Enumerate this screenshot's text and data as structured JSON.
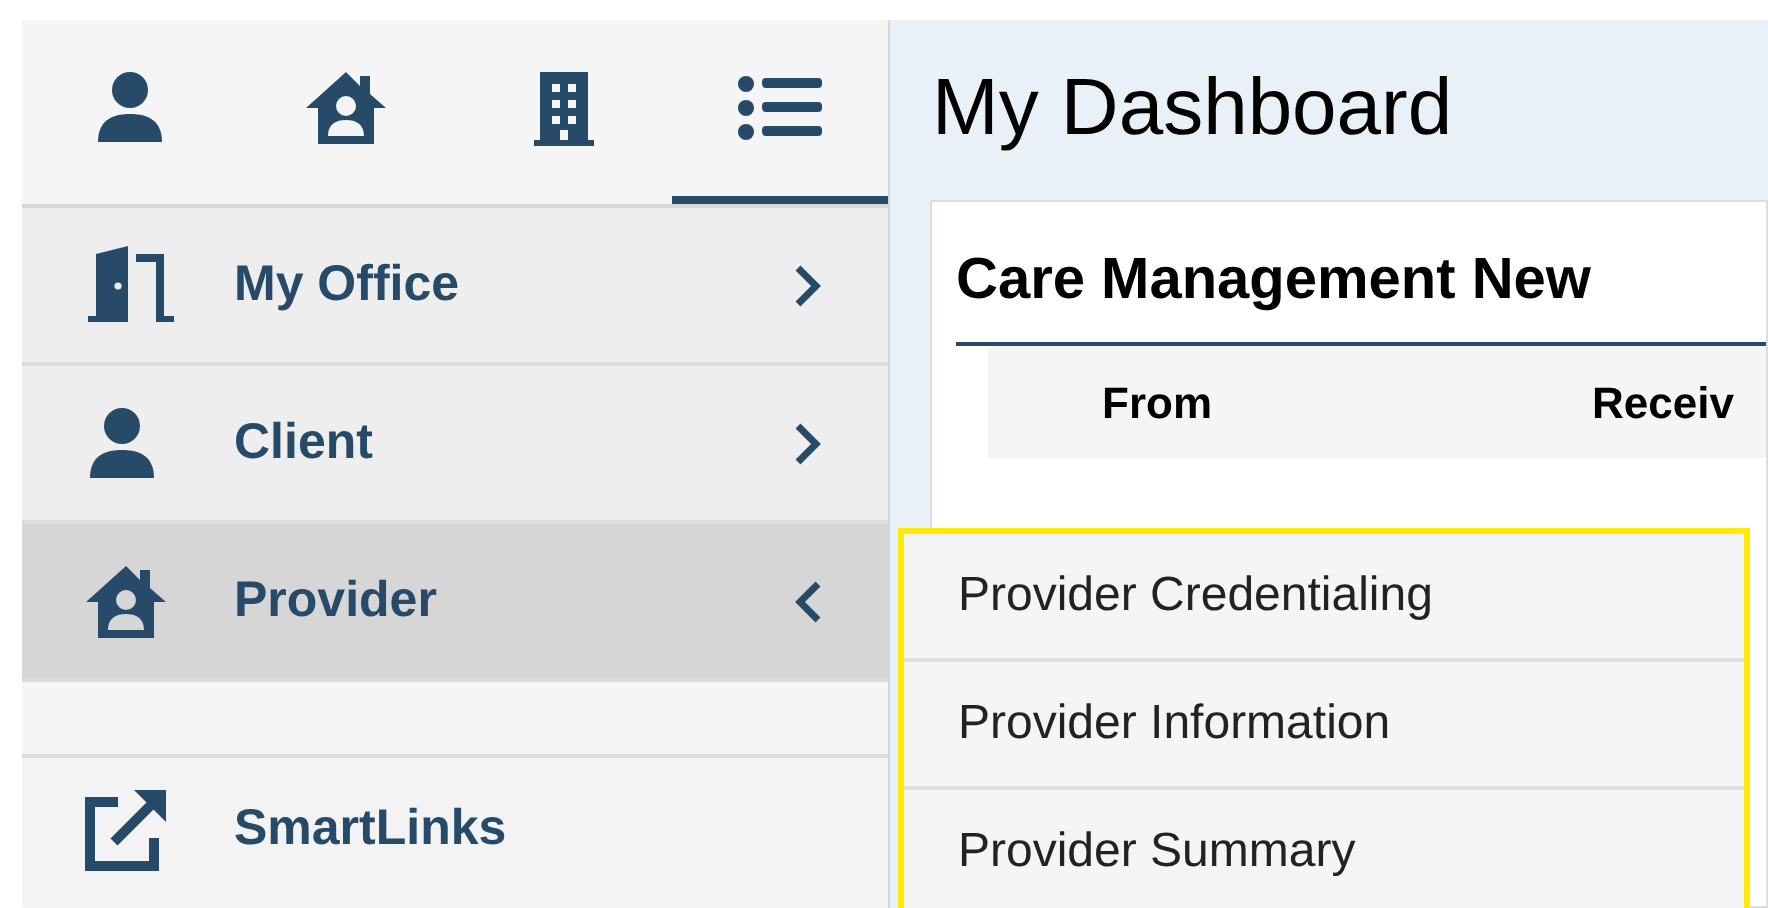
{
  "nav_tabs": [
    {
      "selected": false
    },
    {
      "selected": false
    },
    {
      "selected": false
    },
    {
      "selected": true
    }
  ],
  "sidebar": {
    "items": [
      {
        "label": "My Office",
        "expanded": false,
        "selected": false,
        "kind": "menu"
      },
      {
        "label": "Client",
        "expanded": false,
        "selected": false,
        "kind": "menu"
      },
      {
        "label": "Provider",
        "expanded": true,
        "selected": true,
        "kind": "menu"
      },
      {
        "label": "SmartLinks",
        "kind": "link"
      }
    ]
  },
  "main": {
    "title": "My Dashboard",
    "card": {
      "title": "Care Management New",
      "columns": [
        "From",
        "Receiv"
      ]
    }
  },
  "submenu": {
    "items": [
      {
        "label": "Provider Credentialing"
      },
      {
        "label": "Provider Information"
      },
      {
        "label": "Provider Summary"
      }
    ]
  }
}
